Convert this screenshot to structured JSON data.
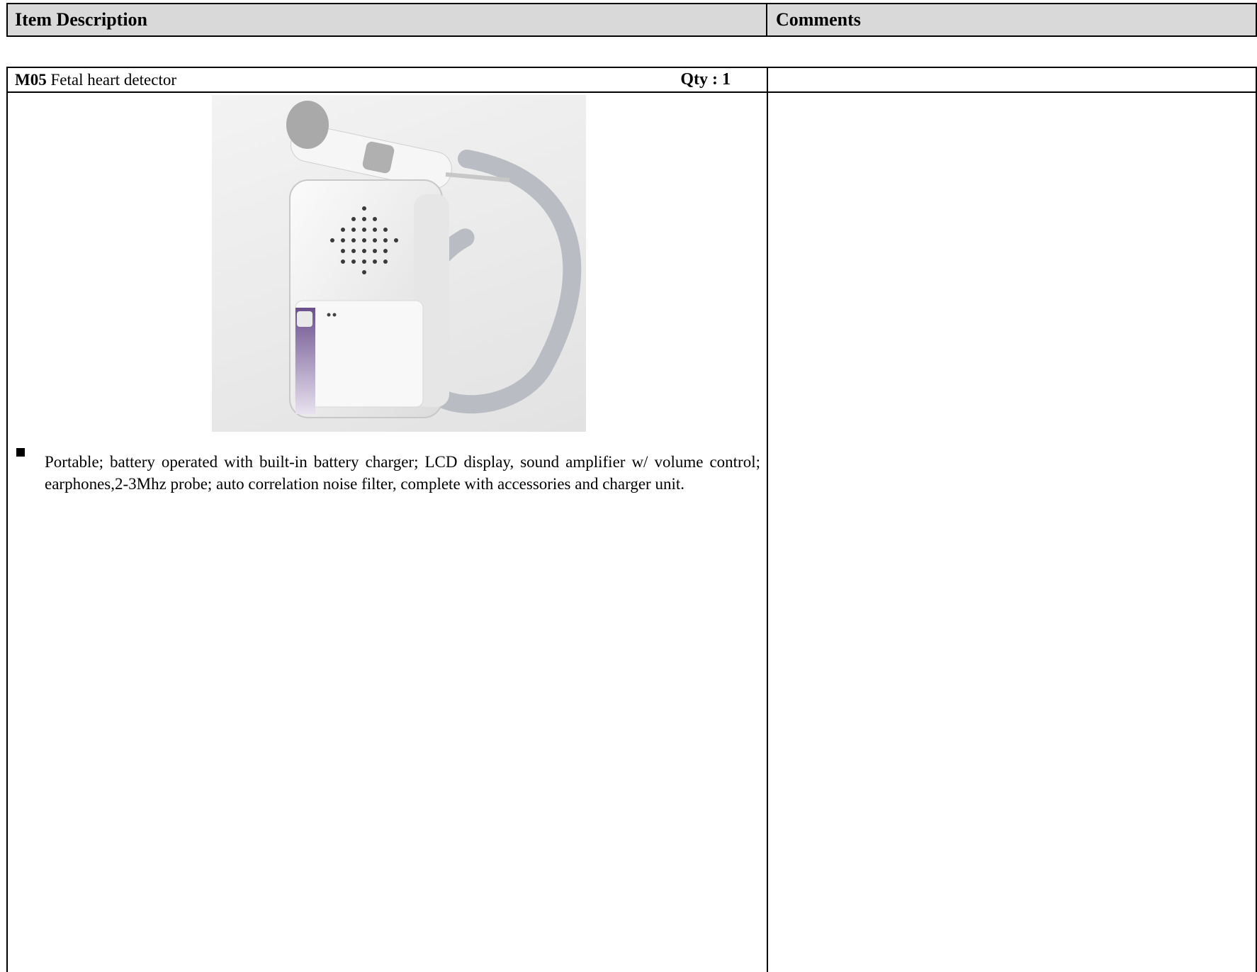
{
  "header": {
    "item_description": "Item Description",
    "comments": "Comments"
  },
  "item": {
    "code": "M05",
    "name": " Fetal heart detector",
    "qty": "Qty :  1",
    "image": {
      "subject": "handheld fetal doppler with coiled cable",
      "colors": {
        "body": "#f2f2f2",
        "accent": "#6b4f8c",
        "cord": "#b9bcc3"
      }
    },
    "description": "Portable; battery operated with built-in battery charger; LCD display, sound amplifier w/ volume control; earphones,2-3Mhz  probe; auto correlation noise filter, complete with accessories and  charger unit.",
    "comment": ""
  }
}
